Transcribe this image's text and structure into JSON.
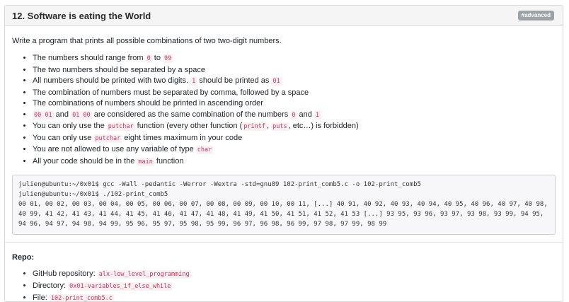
{
  "task": {
    "title": "12. Software is eating the World",
    "badge": "#advanced",
    "intro": "Write a program that prints all possible combinations of two two-digit numbers."
  },
  "requirements": [
    [
      {
        "t": "The numbers should range from "
      },
      {
        "c": "0"
      },
      {
        "t": " to "
      },
      {
        "c": "99"
      }
    ],
    [
      {
        "t": "The two numbers should be separated by a space"
      }
    ],
    [
      {
        "t": "All numbers should be printed with two digits. "
      },
      {
        "c": "1"
      },
      {
        "t": " should be printed as "
      },
      {
        "c": "01"
      }
    ],
    [
      {
        "t": "The combination of numbers must be separated by comma, followed by a space"
      }
    ],
    [
      {
        "t": "The combinations of numbers should be printed in ascending order"
      }
    ],
    [
      {
        "c": "00 01"
      },
      {
        "t": " and "
      },
      {
        "c": "01 00"
      },
      {
        "t": " are considered as the same combination of the numbers "
      },
      {
        "c": "0"
      },
      {
        "t": " and "
      },
      {
        "c": "1"
      }
    ],
    [
      {
        "t": "You can only use the "
      },
      {
        "c": "putchar"
      },
      {
        "t": " function (every other function ("
      },
      {
        "c": "printf"
      },
      {
        "t": ", "
      },
      {
        "c": "puts"
      },
      {
        "t": ", etc…) is forbidden)"
      }
    ],
    [
      {
        "t": "You can only use "
      },
      {
        "c": "putchar"
      },
      {
        "t": " eight times maximum in your code"
      }
    ],
    [
      {
        "t": "You are not allowed to use any variable of type "
      },
      {
        "c": "char"
      }
    ],
    [
      {
        "t": "All your code should be in the "
      },
      {
        "c": "main"
      },
      {
        "t": " function"
      }
    ]
  ],
  "terminal": {
    "lines": [
      "julien@ubuntu:~/0x01$ gcc -Wall -pedantic -Werror -Wextra -std=gnu89 102-print_comb5.c -o 102-print_comb5",
      "julien@ubuntu:~/0x01$ ./102-print_comb5",
      "00 01, 00 02, 00 03, 00 04, 00 05, 00 06, 00 07, 00 08, 00 09, 00 10, 00 11, [...] 40 91, 40 92, 40 93, 40 94, 40 95, 40 96, 40 97, 40 98, 40 99, 41 42, 41 43, 41 44, 41 45, 41 46, 41 47, 41 48, 41 49, 41 50, 41 51, 41 52, 41 53 [...] 93 95, 93 96, 93 97, 93 98, 93 99, 94 95, 94 96, 94 97, 94 98, 94 99, 95 96, 95 97, 95 98, 95 99, 96 97, 96 98, 96 99, 97 98, 97 99, 98 99"
    ]
  },
  "repo": {
    "title": "Repo:",
    "items": [
      {
        "label": "GitHub repository: ",
        "value": "alx-low_level_programming"
      },
      {
        "label": "Directory: ",
        "value": "0x01-variables_if_else_while"
      },
      {
        "label": "File: ",
        "value": "102-print_comb5.c"
      }
    ]
  },
  "colors": {
    "code_text": "#d6335c",
    "badge_bg": "#9ea3a8",
    "header_bg": "#f5f5f5"
  }
}
